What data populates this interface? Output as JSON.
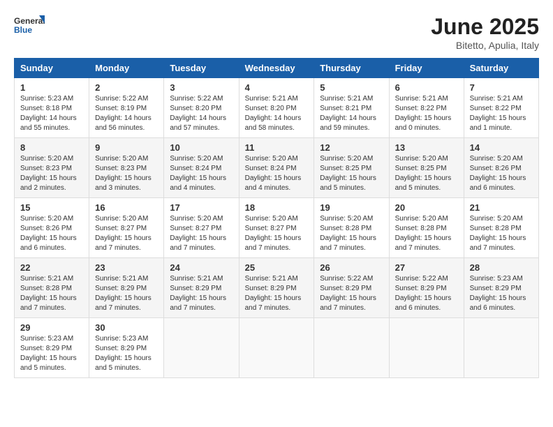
{
  "header": {
    "logo_general": "General",
    "logo_blue": "Blue",
    "month_year": "June 2025",
    "location": "Bitetto, Apulia, Italy"
  },
  "weekdays": [
    "Sunday",
    "Monday",
    "Tuesday",
    "Wednesday",
    "Thursday",
    "Friday",
    "Saturday"
  ],
  "weeks": [
    [
      {
        "day": 1,
        "sunrise": "5:23 AM",
        "sunset": "8:18 PM",
        "daylight": "14 hours and 55 minutes."
      },
      {
        "day": 2,
        "sunrise": "5:22 AM",
        "sunset": "8:19 PM",
        "daylight": "14 hours and 56 minutes."
      },
      {
        "day": 3,
        "sunrise": "5:22 AM",
        "sunset": "8:20 PM",
        "daylight": "14 hours and 57 minutes."
      },
      {
        "day": 4,
        "sunrise": "5:21 AM",
        "sunset": "8:20 PM",
        "daylight": "14 hours and 58 minutes."
      },
      {
        "day": 5,
        "sunrise": "5:21 AM",
        "sunset": "8:21 PM",
        "daylight": "14 hours and 59 minutes."
      },
      {
        "day": 6,
        "sunrise": "5:21 AM",
        "sunset": "8:22 PM",
        "daylight": "15 hours and 0 minutes."
      },
      {
        "day": 7,
        "sunrise": "5:21 AM",
        "sunset": "8:22 PM",
        "daylight": "15 hours and 1 minute."
      }
    ],
    [
      {
        "day": 8,
        "sunrise": "5:20 AM",
        "sunset": "8:23 PM",
        "daylight": "15 hours and 2 minutes."
      },
      {
        "day": 9,
        "sunrise": "5:20 AM",
        "sunset": "8:23 PM",
        "daylight": "15 hours and 3 minutes."
      },
      {
        "day": 10,
        "sunrise": "5:20 AM",
        "sunset": "8:24 PM",
        "daylight": "15 hours and 4 minutes."
      },
      {
        "day": 11,
        "sunrise": "5:20 AM",
        "sunset": "8:24 PM",
        "daylight": "15 hours and 4 minutes."
      },
      {
        "day": 12,
        "sunrise": "5:20 AM",
        "sunset": "8:25 PM",
        "daylight": "15 hours and 5 minutes."
      },
      {
        "day": 13,
        "sunrise": "5:20 AM",
        "sunset": "8:25 PM",
        "daylight": "15 hours and 5 minutes."
      },
      {
        "day": 14,
        "sunrise": "5:20 AM",
        "sunset": "8:26 PM",
        "daylight": "15 hours and 6 minutes."
      }
    ],
    [
      {
        "day": 15,
        "sunrise": "5:20 AM",
        "sunset": "8:26 PM",
        "daylight": "15 hours and 6 minutes."
      },
      {
        "day": 16,
        "sunrise": "5:20 AM",
        "sunset": "8:27 PM",
        "daylight": "15 hours and 7 minutes."
      },
      {
        "day": 17,
        "sunrise": "5:20 AM",
        "sunset": "8:27 PM",
        "daylight": "15 hours and 7 minutes."
      },
      {
        "day": 18,
        "sunrise": "5:20 AM",
        "sunset": "8:27 PM",
        "daylight": "15 hours and 7 minutes."
      },
      {
        "day": 19,
        "sunrise": "5:20 AM",
        "sunset": "8:28 PM",
        "daylight": "15 hours and 7 minutes."
      },
      {
        "day": 20,
        "sunrise": "5:20 AM",
        "sunset": "8:28 PM",
        "daylight": "15 hours and 7 minutes."
      },
      {
        "day": 21,
        "sunrise": "5:20 AM",
        "sunset": "8:28 PM",
        "daylight": "15 hours and 7 minutes."
      }
    ],
    [
      {
        "day": 22,
        "sunrise": "5:21 AM",
        "sunset": "8:28 PM",
        "daylight": "15 hours and 7 minutes."
      },
      {
        "day": 23,
        "sunrise": "5:21 AM",
        "sunset": "8:29 PM",
        "daylight": "15 hours and 7 minutes."
      },
      {
        "day": 24,
        "sunrise": "5:21 AM",
        "sunset": "8:29 PM",
        "daylight": "15 hours and 7 minutes."
      },
      {
        "day": 25,
        "sunrise": "5:21 AM",
        "sunset": "8:29 PM",
        "daylight": "15 hours and 7 minutes."
      },
      {
        "day": 26,
        "sunrise": "5:22 AM",
        "sunset": "8:29 PM",
        "daylight": "15 hours and 7 minutes."
      },
      {
        "day": 27,
        "sunrise": "5:22 AM",
        "sunset": "8:29 PM",
        "daylight": "15 hours and 6 minutes."
      },
      {
        "day": 28,
        "sunrise": "5:23 AM",
        "sunset": "8:29 PM",
        "daylight": "15 hours and 6 minutes."
      }
    ],
    [
      {
        "day": 29,
        "sunrise": "5:23 AM",
        "sunset": "8:29 PM",
        "daylight": "15 hours and 5 minutes."
      },
      {
        "day": 30,
        "sunrise": "5:23 AM",
        "sunset": "8:29 PM",
        "daylight": "15 hours and 5 minutes."
      },
      null,
      null,
      null,
      null,
      null
    ]
  ],
  "labels": {
    "sunrise": "Sunrise:",
    "sunset": "Sunset:",
    "daylight": "Daylight:"
  }
}
